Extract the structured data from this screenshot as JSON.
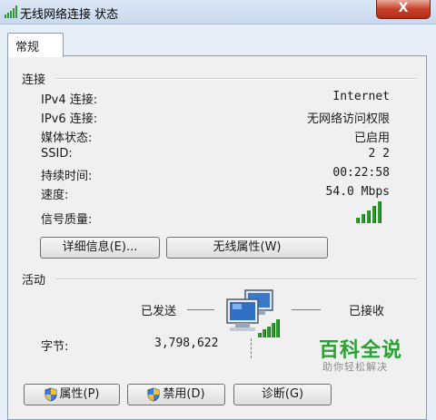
{
  "window": {
    "title": "无线网络连接 状态",
    "close_label": "X"
  },
  "tabs": [
    {
      "label": "常规"
    }
  ],
  "connection": {
    "section_title": "连接",
    "rows": [
      {
        "label": "IPv4 连接:",
        "value": "Internet"
      },
      {
        "label": "IPv6 连接:",
        "value": "无网络访问权限"
      },
      {
        "label": "媒体状态:",
        "value": "已启用"
      },
      {
        "label": "SSID:",
        "value": "2 2"
      },
      {
        "label": "持续时间:",
        "value": "00:22:58"
      },
      {
        "label": "速度:",
        "value": "54.0 Mbps"
      }
    ],
    "signal_label": "信号质量:",
    "signal_bars": 5,
    "details_button": "详细信息(E)...",
    "wireless_props_button": "无线属性(W)"
  },
  "activity": {
    "section_title": "活动",
    "sent_label": "已发送",
    "received_label": "已接收",
    "bytes_label": "字节:",
    "bytes_sent": "3,798,622"
  },
  "footer_buttons": {
    "properties": "属性(P)",
    "disable": "禁用(D)",
    "diagnose": "诊断(G)"
  },
  "watermark": {
    "title": "百科全说",
    "subtitle": "助你轻松解决"
  },
  "colors": {
    "signal": "#2e9a2e",
    "watermark": "#2aa135",
    "close": "#c8402a"
  }
}
